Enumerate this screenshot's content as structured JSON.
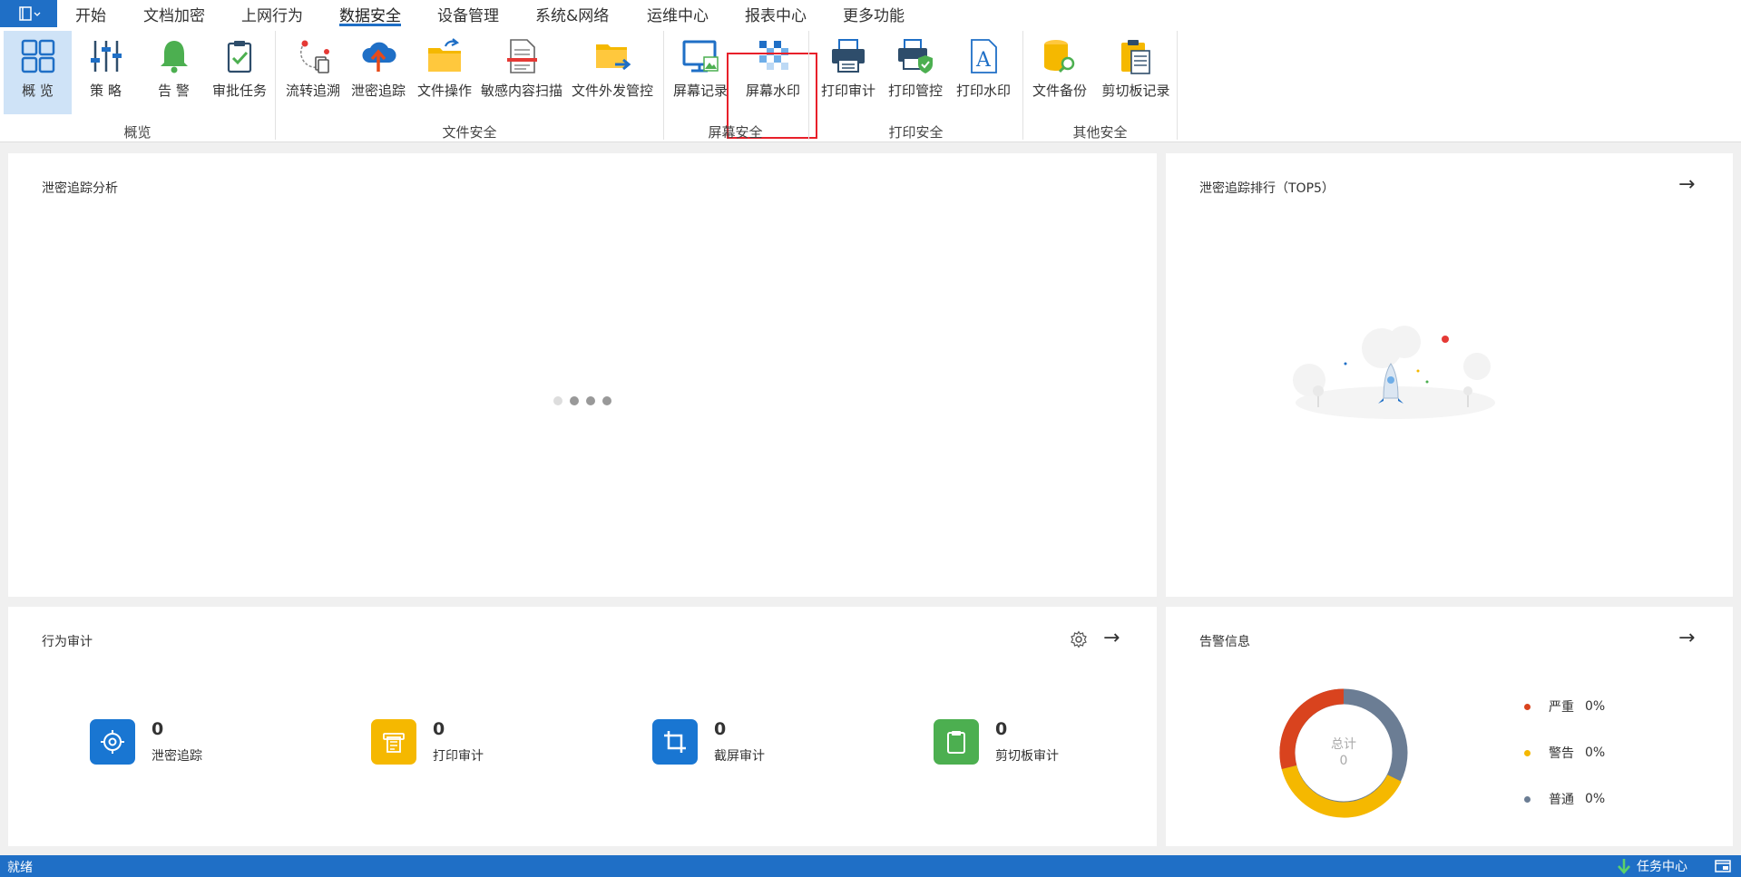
{
  "menu": {
    "items": [
      "开始",
      "文档加密",
      "上网行为",
      "数据安全",
      "设备管理",
      "系统&网络",
      "运维中心",
      "报表中心",
      "更多功能"
    ]
  },
  "ribbon": {
    "buttons": {
      "overview": "概 览",
      "policy": "策 略",
      "alert": "告 警",
      "approval": "审批任务",
      "flow_trace": "流转追溯",
      "leak_trace": "泄密追踪",
      "file_ops": "文件操作",
      "sensitive_scan": "敏感内容扫描",
      "file_outbound": "文件外发管控",
      "screen_record": "屏幕记录",
      "screen_watermark": "屏幕水印",
      "print_audit": "打印审计",
      "print_control": "打印管控",
      "print_watermark": "打印水印",
      "file_backup": "文件备份",
      "clipboard_record": "剪切板记录"
    },
    "groups": {
      "overview": "概览",
      "file_security": "文件安全",
      "screen_security": "屏幕安全",
      "print_security": "打印安全",
      "other_security": "其他安全"
    }
  },
  "panels": {
    "leak_analysis": {
      "title": "泄密追踪分析"
    },
    "leak_rank": {
      "title": "泄密追踪排行（TOP5）"
    },
    "behavior_audit": {
      "title": "行为审计",
      "stats": [
        {
          "value": "0",
          "label": "泄密追踪",
          "color": "#1976d2",
          "icon": "target-icon"
        },
        {
          "value": "0",
          "label": "打印审计",
          "color": "#f5b800",
          "icon": "print-doc-icon"
        },
        {
          "value": "0",
          "label": "截屏审计",
          "color": "#1976d2",
          "icon": "crop-icon"
        },
        {
          "value": "0",
          "label": "剪切板审计",
          "color": "#4caf50",
          "icon": "clipboard-icon"
        }
      ]
    },
    "alerts": {
      "title": "告警信息",
      "center_label": "总计",
      "center_value": "0",
      "legend": [
        {
          "label": "严重",
          "percent": "0%",
          "color": "#d9431e"
        },
        {
          "label": "警告",
          "percent": "0%",
          "color": "#f5b800"
        },
        {
          "label": "普通",
          "percent": "0%",
          "color": "#6b7d94"
        }
      ]
    }
  },
  "status": {
    "text": "就绪",
    "task_center": "任务中心"
  }
}
